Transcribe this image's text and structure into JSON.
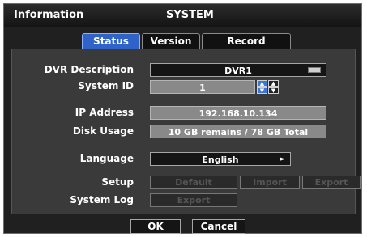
{
  "window": {
    "title_left": "Information",
    "title_center": "SYSTEM"
  },
  "tabs": [
    {
      "label": "Status",
      "active": true
    },
    {
      "label": "Version",
      "active": false
    },
    {
      "label": "Record",
      "active": false
    }
  ],
  "form": {
    "dvr_description": {
      "label": "DVR Description",
      "value": "DVR1",
      "icon": "keyboard-icon"
    },
    "system_id": {
      "label": "System ID",
      "value": "1",
      "icons": [
        "spin-up-icon",
        "spin-down-icon"
      ]
    },
    "ip_address": {
      "label": "IP Address",
      "value": "192.168.10.134"
    },
    "disk_usage": {
      "label": "Disk Usage",
      "value": "10 GB remains / 78 GB Total"
    },
    "language": {
      "label": "Language",
      "value": "English",
      "icon": "arrow-right-icon"
    },
    "setup": {
      "label": "Setup",
      "buttons": [
        "Default",
        "Import",
        "Export"
      ]
    },
    "system_log": {
      "label": "System Log",
      "buttons": [
        "Export"
      ]
    }
  },
  "footer": {
    "ok_label": "OK",
    "cancel_label": "Cancel"
  },
  "colors": {
    "accent": "#2f63c8",
    "panel": "#3a3a3a",
    "window": "#202020"
  }
}
